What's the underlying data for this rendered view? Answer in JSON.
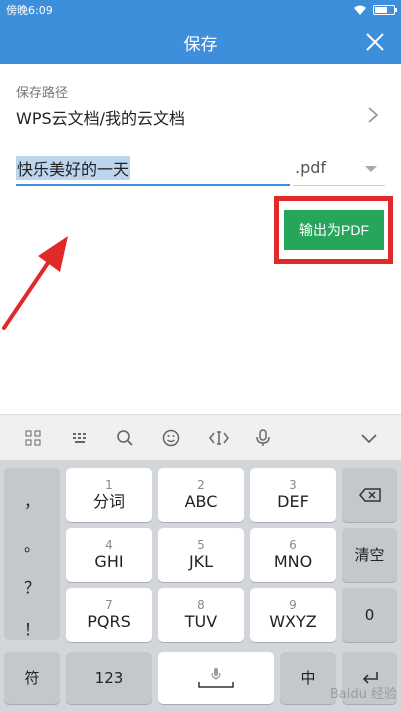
{
  "status_bar": {
    "time": "傍晚6:09"
  },
  "header": {
    "title": "保存"
  },
  "save_path": {
    "label": "保存路径",
    "value": "WPS云文档/我的云文档"
  },
  "file": {
    "name": "快乐美好的一天",
    "extension": ".pdf"
  },
  "export_button": {
    "label": "输出为PDF"
  },
  "keyboard": {
    "side_keys": [
      "，",
      "。",
      "？",
      "！"
    ],
    "rows": [
      [
        {
          "num": "1",
          "letters": "分词"
        },
        {
          "num": "2",
          "letters": "ABC"
        },
        {
          "num": "3",
          "letters": "DEF"
        }
      ],
      [
        {
          "num": "4",
          "letters": "GHI"
        },
        {
          "num": "5",
          "letters": "JKL"
        },
        {
          "num": "6",
          "letters": "MNO"
        }
      ],
      [
        {
          "num": "7",
          "letters": "PQRS"
        },
        {
          "num": "8",
          "letters": "TUV"
        },
        {
          "num": "9",
          "letters": "WXYZ"
        }
      ]
    ],
    "clear_label": "清空",
    "zero_label": "0",
    "symbol_label": "符",
    "numbers_label": "123",
    "lang_label": "中"
  },
  "watermark": {
    "text": "Baidu 经验"
  },
  "colors": {
    "primary": "#3d8fdc",
    "export_green": "#26a65b",
    "annotation_red": "#e02a2a"
  }
}
